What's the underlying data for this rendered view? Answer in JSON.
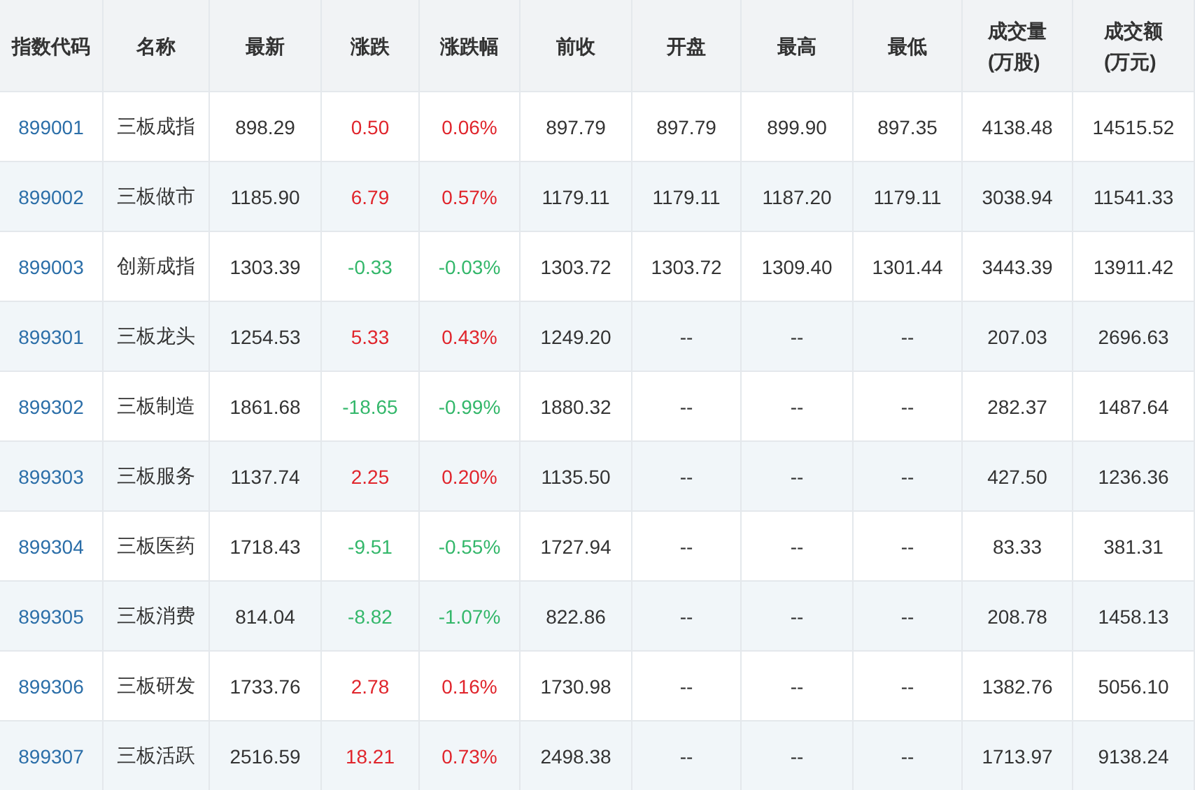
{
  "table": {
    "columns": [
      {
        "label": "指数代码"
      },
      {
        "label": "名称"
      },
      {
        "label": "最新"
      },
      {
        "label": "涨跌"
      },
      {
        "label": "涨跌幅"
      },
      {
        "label": "前收"
      },
      {
        "label": "开盘"
      },
      {
        "label": "最高"
      },
      {
        "label": "最低"
      },
      {
        "label": "成交量",
        "unit": "(万股)"
      },
      {
        "label": "成交额",
        "unit": "(万元)"
      }
    ],
    "rows": [
      {
        "code": "899001",
        "name": "三板成指",
        "last": "898.29",
        "change": "0.50",
        "pct": "0.06%",
        "prev": "897.79",
        "open": "897.79",
        "high": "899.90",
        "low": "897.35",
        "volume": "4138.48",
        "amount": "14515.52",
        "color": "#e0252c"
      },
      {
        "code": "899002",
        "name": "三板做市",
        "last": "1185.90",
        "change": "6.79",
        "pct": "0.57%",
        "prev": "1179.11",
        "open": "1179.11",
        "high": "1187.20",
        "low": "1179.11",
        "volume": "3038.94",
        "amount": "11541.33",
        "color": "#e0252c"
      },
      {
        "code": "899003",
        "name": "创新成指",
        "last": "1303.39",
        "change": "-0.33",
        "pct": "-0.03%",
        "prev": "1303.72",
        "open": "1303.72",
        "high": "1309.40",
        "low": "1301.44",
        "volume": "3443.39",
        "amount": "13911.42",
        "color": "#33b76a"
      },
      {
        "code": "899301",
        "name": "三板龙头",
        "last": "1254.53",
        "change": "5.33",
        "pct": "0.43%",
        "prev": "1249.20",
        "open": "--",
        "high": "--",
        "low": "--",
        "volume": "207.03",
        "amount": "2696.63",
        "color": "#e0252c"
      },
      {
        "code": "899302",
        "name": "三板制造",
        "last": "1861.68",
        "change": "-18.65",
        "pct": "-0.99%",
        "prev": "1880.32",
        "open": "--",
        "high": "--",
        "low": "--",
        "volume": "282.37",
        "amount": "1487.64",
        "color": "#33b76a"
      },
      {
        "code": "899303",
        "name": "三板服务",
        "last": "1137.74",
        "change": "2.25",
        "pct": "0.20%",
        "prev": "1135.50",
        "open": "--",
        "high": "--",
        "low": "--",
        "volume": "427.50",
        "amount": "1236.36",
        "color": "#e0252c"
      },
      {
        "code": "899304",
        "name": "三板医药",
        "last": "1718.43",
        "change": "-9.51",
        "pct": "-0.55%",
        "prev": "1727.94",
        "open": "--",
        "high": "--",
        "low": "--",
        "volume": "83.33",
        "amount": "381.31",
        "color": "#33b76a"
      },
      {
        "code": "899305",
        "name": "三板消费",
        "last": "814.04",
        "change": "-8.82",
        "pct": "-1.07%",
        "prev": "822.86",
        "open": "--",
        "high": "--",
        "low": "--",
        "volume": "208.78",
        "amount": "1458.13",
        "color": "#33b76a"
      },
      {
        "code": "899306",
        "name": "三板研发",
        "last": "1733.76",
        "change": "2.78",
        "pct": "0.16%",
        "prev": "1730.98",
        "open": "--",
        "high": "--",
        "low": "--",
        "volume": "1382.76",
        "amount": "5056.10",
        "color": "#e0252c"
      },
      {
        "code": "899307",
        "name": "三板活跃",
        "last": "2516.59",
        "change": "18.21",
        "pct": "0.73%",
        "prev": "2498.38",
        "open": "--",
        "high": "--",
        "low": "--",
        "volume": "1713.97",
        "amount": "9138.24",
        "color": "#e0252c"
      }
    ]
  }
}
